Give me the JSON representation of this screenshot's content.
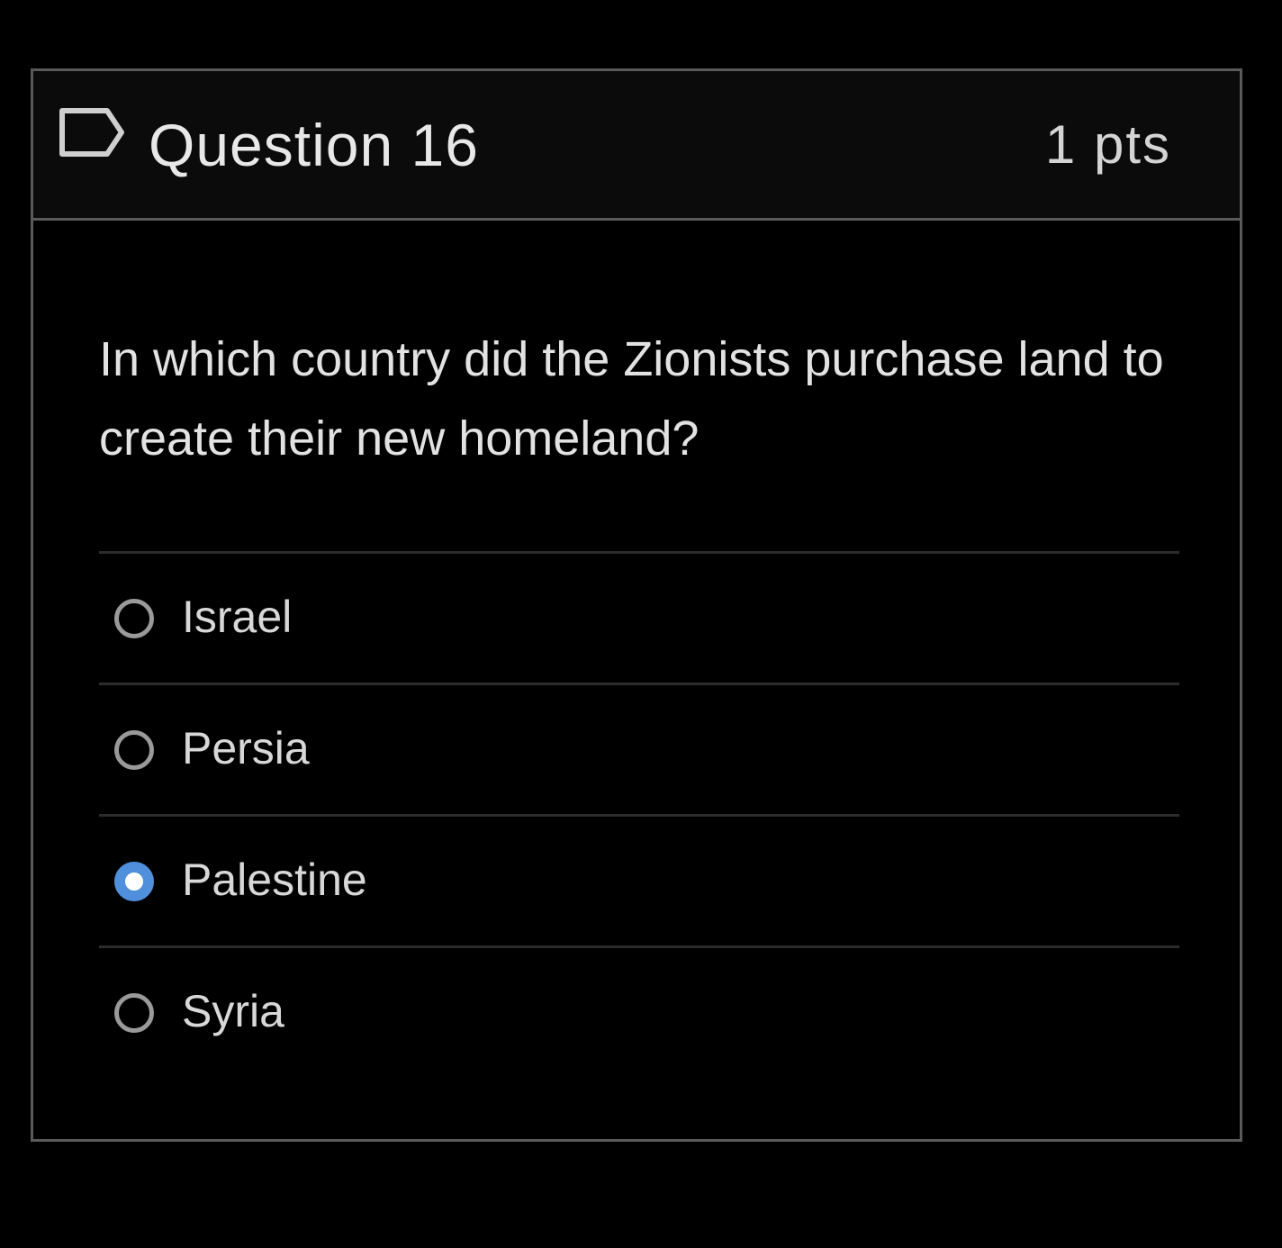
{
  "question": {
    "title": "Question 16",
    "points": "1 pts",
    "text": "In which country did the Zionists purchase land to create their new homeland?",
    "flag_icon": "flag-outline-icon"
  },
  "answers": [
    {
      "label": "Israel",
      "selected": false
    },
    {
      "label": "Persia",
      "selected": false
    },
    {
      "label": "Palestine",
      "selected": true
    },
    {
      "label": "Syria",
      "selected": false
    }
  ],
  "colors": {
    "background": "#000000",
    "border": "#5a5a5a",
    "selected_radio": "#4f8fdc",
    "text": "#e2e2e2"
  }
}
